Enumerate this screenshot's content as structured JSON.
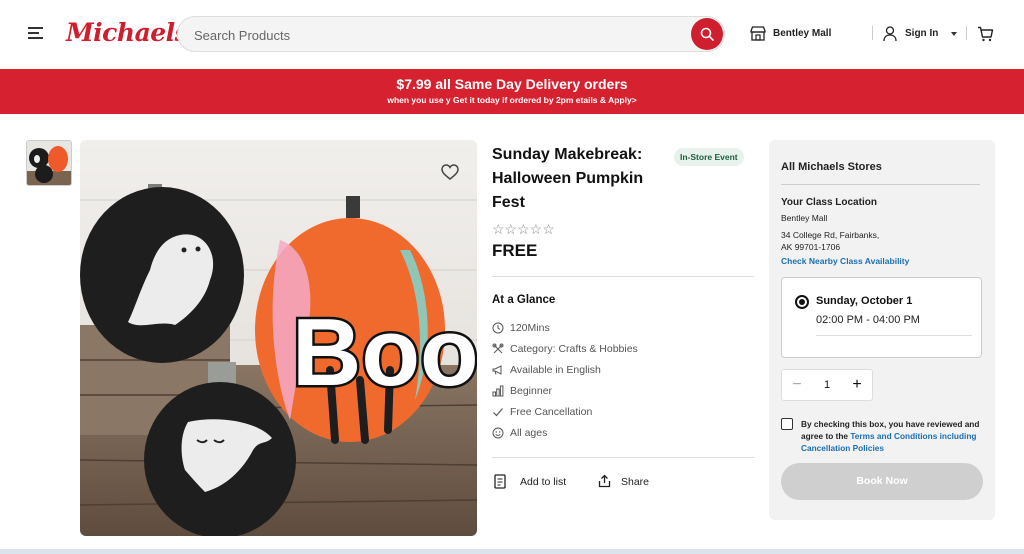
{
  "header": {
    "logo": "Michaels",
    "search_placeholder": "Search Products",
    "store_label": "Bentley Mall",
    "signin_label": "Sign In"
  },
  "promo": {
    "title": "$7.99 all Same Day Delivery orders",
    "subtitle": "when you use y Get it today if ordered by 2pm etails & Apply>"
  },
  "product": {
    "title_lines": [
      "Sunday Makebreak:",
      "Halloween Pumpkin",
      "Fest"
    ],
    "badge": "In-Store Event",
    "stars": "☆☆☆☆☆",
    "price": "FREE",
    "glance_title": "At a Glance",
    "glance_items": [
      {
        "icon": "clock-icon",
        "label": "120Mins"
      },
      {
        "icon": "craft-icon",
        "label": "Category: Crafts & Hobbies"
      },
      {
        "icon": "megaphone-icon",
        "label": "Available in English"
      },
      {
        "icon": "bars-icon",
        "label": "Beginner"
      },
      {
        "icon": "check-icon",
        "label": "Free Cancellation"
      },
      {
        "icon": "smile-icon",
        "label": "All ages"
      }
    ],
    "add_to_list": "Add to list",
    "share": "Share",
    "image_text": "Boo"
  },
  "panel": {
    "store_title": "All Michaels Stores",
    "location_title": "Your Class Location",
    "location_name": "Bentley Mall",
    "address_line1": "34 College Rd, Fairbanks,",
    "address_line2": "AK 99701-1706",
    "nearby_link": "Check Nearby Class Availability",
    "date": "Sunday, October 1",
    "time": "02:00 PM - 04:00 PM",
    "quantity": "1",
    "minus": "−",
    "plus": "+",
    "agree_prefix": "By checking this box, you have reviewed and agree to the ",
    "agree_link": "Terms and Conditions including Cancellation Policies",
    "book_label": "Book Now"
  },
  "colors": {
    "brand_red": "#cf1f2e",
    "promo_red": "#d62230",
    "link_blue": "#1a6fb5",
    "badge_bg": "#e8f2ec"
  }
}
